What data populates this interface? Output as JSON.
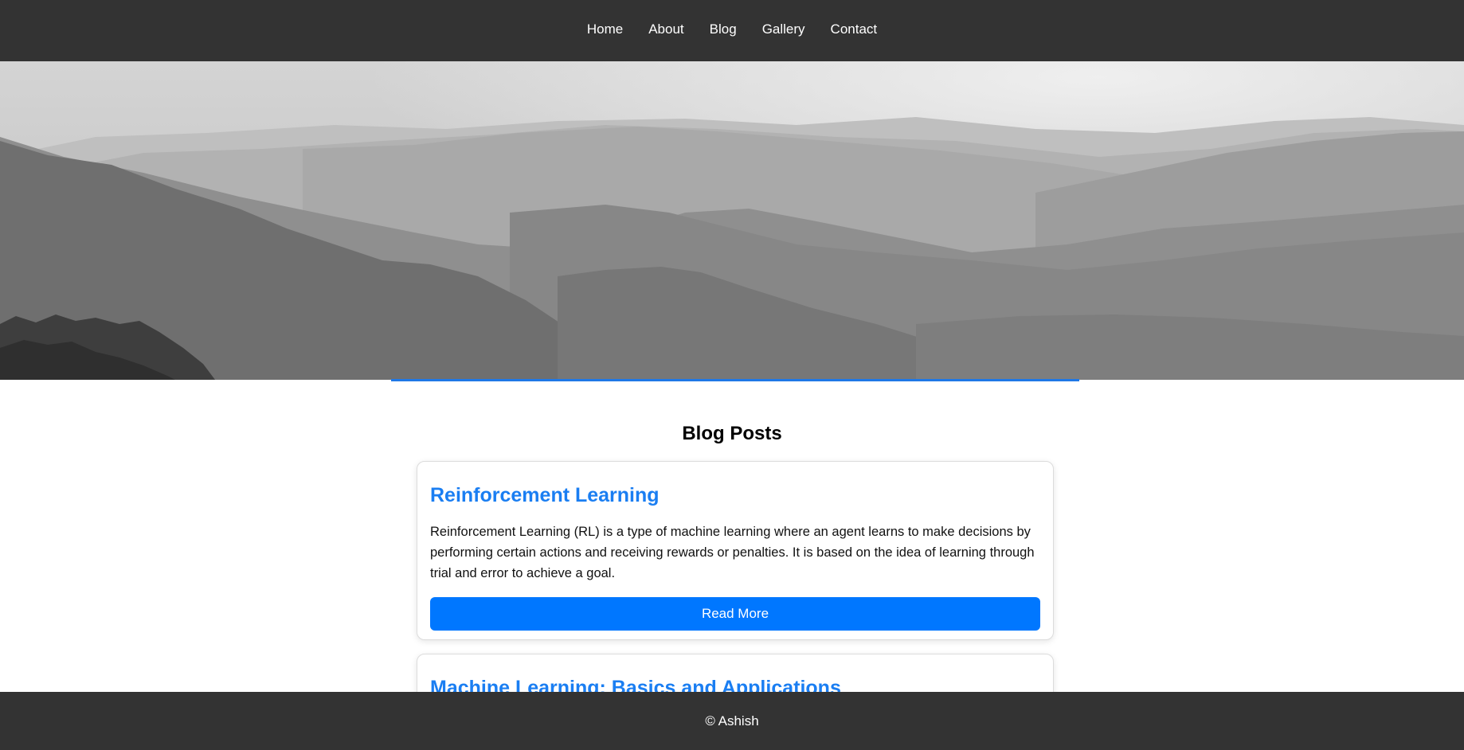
{
  "nav": {
    "items": [
      {
        "label": "Home"
      },
      {
        "label": "About"
      },
      {
        "label": "Blog"
      },
      {
        "label": "Gallery"
      },
      {
        "label": "Contact"
      }
    ]
  },
  "colors": {
    "nav_bg": "#333333",
    "accent": "#0077ff",
    "title_blue": "#1a7ef2",
    "underline": "#1f78e6"
  },
  "main": {
    "section_title": "Blog Posts",
    "posts": [
      {
        "title": "Reinforcement Learning",
        "text": "Reinforcement Learning (RL) is a type of machine learning where an agent learns to make decisions by performing certain actions and receiving rewards or penalties. It is based on the idea of learning through trial and error to achieve a goal.",
        "button_label": "Read More"
      },
      {
        "title": "Machine Learning: Basics and Applications"
      }
    ]
  },
  "footer": {
    "text": "© Ashish"
  }
}
